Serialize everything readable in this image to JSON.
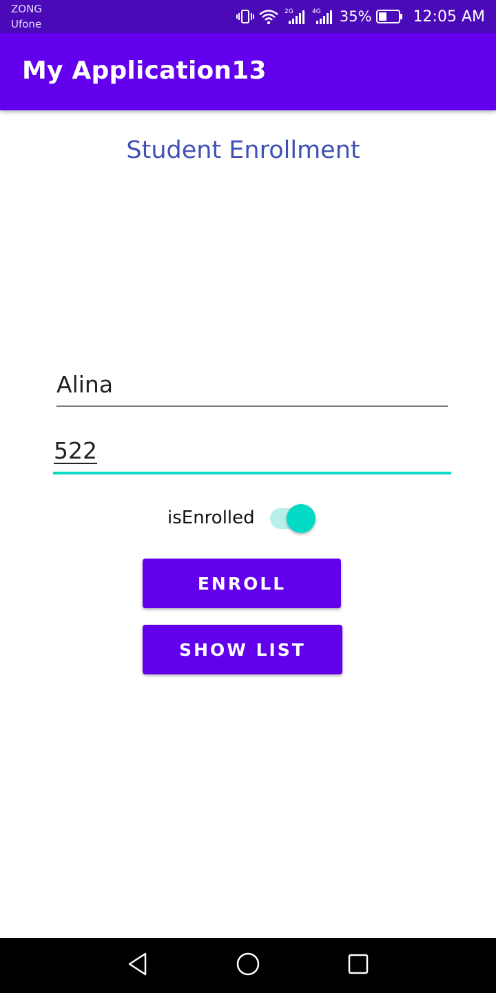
{
  "status_bar": {
    "carrier_1": "ZONG",
    "carrier_2": "Ufone",
    "network_1": "2G",
    "network_2": "4G",
    "battery_percent": "35%",
    "time": "12:05 AM",
    "icons": [
      "vibrate-icon",
      "wifi-icon",
      "signal-2g-icon",
      "signal-4g-icon",
      "battery-icon"
    ]
  },
  "app_bar": {
    "title": "My Application13"
  },
  "main": {
    "heading": "Student Enrollment",
    "name_field": {
      "value": "Alina"
    },
    "id_field": {
      "value": "522"
    },
    "enrolled_switch": {
      "label": "isEnrolled",
      "checked": true
    },
    "enroll_button": {
      "label": "ENROLL"
    },
    "show_list_button": {
      "label": "SHOW LIST"
    }
  },
  "nav_bar": {
    "icons": [
      "back-icon",
      "home-icon",
      "recents-icon"
    ]
  },
  "colors": {
    "status_bar": "#4a0ab8",
    "primary": "#6200ee",
    "accent": "#03dac5",
    "heading": "#3f51b5"
  }
}
